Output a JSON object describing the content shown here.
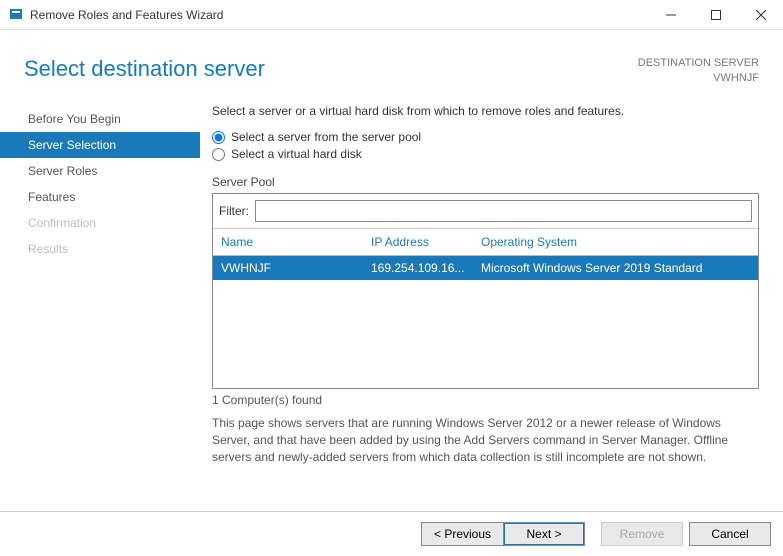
{
  "titlebar": {
    "title": "Remove Roles and Features Wizard"
  },
  "header": {
    "title": "Select destination server",
    "dest_label": "DESTINATION SERVER",
    "dest_server": "VWHNJF"
  },
  "steps": [
    {
      "label": "Before You Begin",
      "state": "enabled"
    },
    {
      "label": "Server Selection",
      "state": "selected"
    },
    {
      "label": "Server Roles",
      "state": "enabled"
    },
    {
      "label": "Features",
      "state": "enabled"
    },
    {
      "label": "Confirmation",
      "state": "disabled"
    },
    {
      "label": "Results",
      "state": "disabled"
    }
  ],
  "main": {
    "intro": "Select a server or a virtual hard disk from which to remove roles and features.",
    "radio_pool": "Select a server from the server pool",
    "radio_vhd": "Select a virtual hard disk",
    "pool_label": "Server Pool",
    "filter_label": "Filter:",
    "filter_value": "",
    "cols": {
      "name": "Name",
      "ip": "IP Address",
      "os": "Operating System"
    },
    "rows": [
      {
        "name": "VWHNJF",
        "ip": "169.254.109.16...",
        "os": "Microsoft Windows Server 2019 Standard"
      }
    ],
    "count": "1 Computer(s) found",
    "help": "This page shows servers that are running Windows Server 2012 or a newer release of Windows Server, and that have been added by using the Add Servers command in Server Manager. Offline servers and newly-added servers from which data collection is still incomplete are not shown."
  },
  "footer": {
    "previous": "< Previous",
    "next": "Next >",
    "remove": "Remove",
    "cancel": "Cancel"
  }
}
